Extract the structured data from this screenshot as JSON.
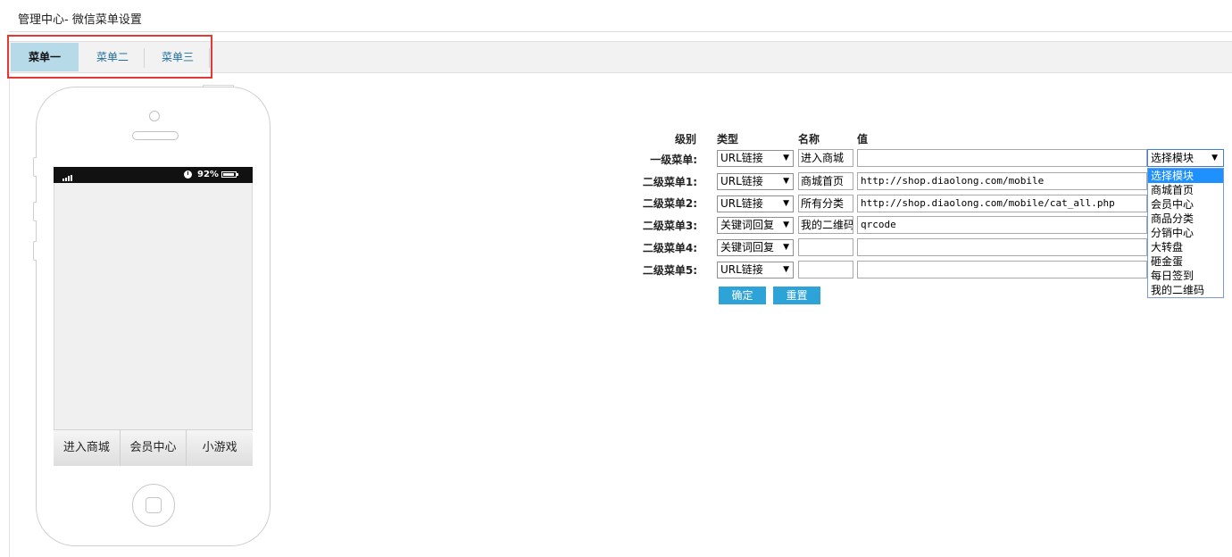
{
  "page": {
    "title": "管理中心- 微信菜单设置"
  },
  "tabs": [
    {
      "label": "菜单一",
      "active": true
    },
    {
      "label": "菜单二",
      "active": false
    },
    {
      "label": "菜单三",
      "active": false
    }
  ],
  "phone": {
    "battery": "92%",
    "menu": [
      "进入商城",
      "会员中心",
      "小游戏"
    ]
  },
  "form": {
    "headers": {
      "level": "级别",
      "type": "类型",
      "name": "名称",
      "value": "值"
    },
    "rows": [
      {
        "label": "一级菜单:",
        "type": "URL链接",
        "name": "进入商城",
        "value": ""
      },
      {
        "label": "二级菜单1:",
        "type": "URL链接",
        "name": "商城首页",
        "value": "http://shop.diaolong.com/mobile"
      },
      {
        "label": "二级菜单2:",
        "type": "URL链接",
        "name": "所有分类",
        "value": "http://shop.diaolong.com/mobile/cat_all.php"
      },
      {
        "label": "二级菜单3:",
        "type": "关键词回复",
        "name": "我的二维码",
        "value": "qrcode"
      },
      {
        "label": "二级菜单4:",
        "type": "关键词回复",
        "name": "",
        "value": ""
      },
      {
        "label": "二级菜单5:",
        "type": "URL链接",
        "name": "",
        "value": ""
      }
    ],
    "module_select": {
      "selected": "选择模块",
      "options": [
        "选择模块",
        "商城首页",
        "会员中心",
        "商品分类",
        "分销中心",
        "大转盘",
        "砸金蛋",
        "每日签到",
        "我的二维码"
      ]
    },
    "confirm_label": "确定",
    "reset_label": "重置"
  },
  "colors": {
    "accent": "#2ea3d8",
    "active_tab": "#b7dae9",
    "highlight": "#e53935",
    "dropdown_selected": "#1e90ff"
  }
}
